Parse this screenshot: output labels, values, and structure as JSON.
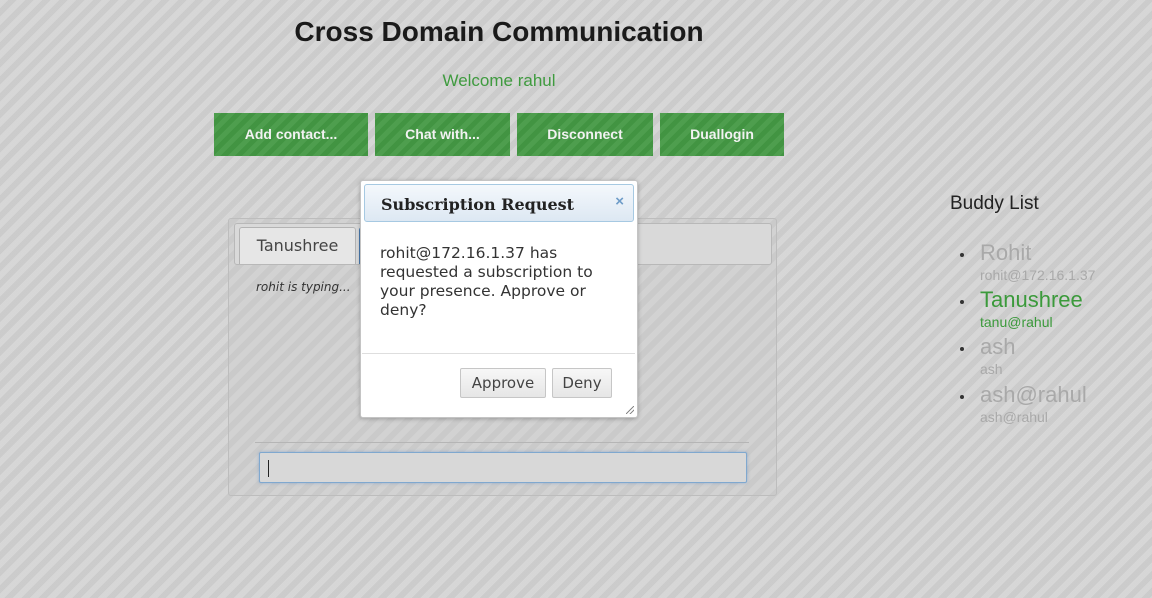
{
  "header": {
    "title": "Cross Domain Communication",
    "welcome": "Welcome rahul"
  },
  "toolbar": {
    "buttons": [
      "Add contact...",
      "Chat with...",
      "Disconnect",
      "Duallogin"
    ]
  },
  "chat": {
    "tabs": [
      "Tanushree",
      ""
    ],
    "typing_status": "rohit is typing...",
    "input_value": ""
  },
  "dialog": {
    "title": "Subscription Request",
    "close_symbol": "×",
    "message": "rohit@172.16.1.37 has requested a subscription to your presence. Approve or deny?",
    "approve_label": "Approve",
    "deny_label": "Deny"
  },
  "buddy_list": {
    "heading": "Buddy List",
    "items": [
      {
        "name": "Rohit",
        "jid": "rohit@172.16.1.37",
        "status": "offline"
      },
      {
        "name": "Tanushree",
        "jid": "tanu@rahul",
        "status": "online"
      },
      {
        "name": "ash",
        "jid": "ash",
        "status": "offline"
      },
      {
        "name": "ash@rahul",
        "jid": "ash@rahul",
        "status": "offline"
      }
    ]
  },
  "colors": {
    "accent_green": "#449944",
    "online_green": "#3b9a3b",
    "offline_gray": "#a9a9a9",
    "dialog_titlebar": "#dde8f3"
  }
}
